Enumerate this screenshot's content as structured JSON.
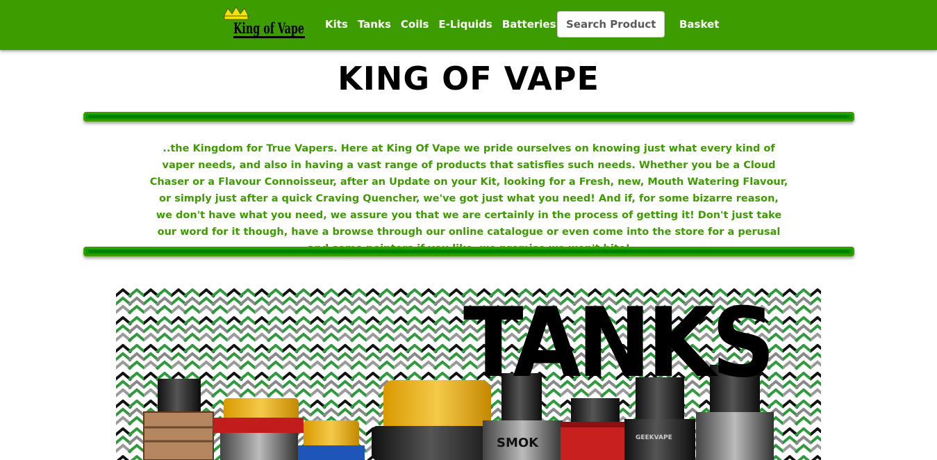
{
  "nav": {
    "logo_text": "King of Vape",
    "links": [
      "Kits",
      "Tanks",
      "Coils",
      "E-Liquids",
      "Batteries"
    ],
    "search_placeholder": "Search Products",
    "basket_label": "Basket"
  },
  "page": {
    "title": "KING OF VAPE",
    "intro": "..the Kingdom for True Vapers. Here at King Of Vape we pride ourselves on knowing just what every kind of vaper needs, and also in having a vast range of products that satisfies such needs. Whether you be a Cloud Chaser or a Flavour Connoisseur, after an Update on your Kit, looking for a Fresh, new, Mouth Watering Flavour, or simply just after a quick Craving Quencher, we've got just what you need! And if, for some bizarre reason, we don't have what you need, we assure you that we are certainly in the process of getting it! Don't just take our word for it though, have a browse through our online catalogue or even come into the store for a perusal and some pointers if you like, we promise we won't bite!"
  },
  "banner": {
    "title": "TANKS",
    "label_smok": "SMOK",
    "label_geekvape": "GEEKVAPE"
  },
  "colors": {
    "brand_green": "#3d9c00",
    "text_green": "#3d9c00",
    "pattern_green": "#2e9a3c"
  }
}
